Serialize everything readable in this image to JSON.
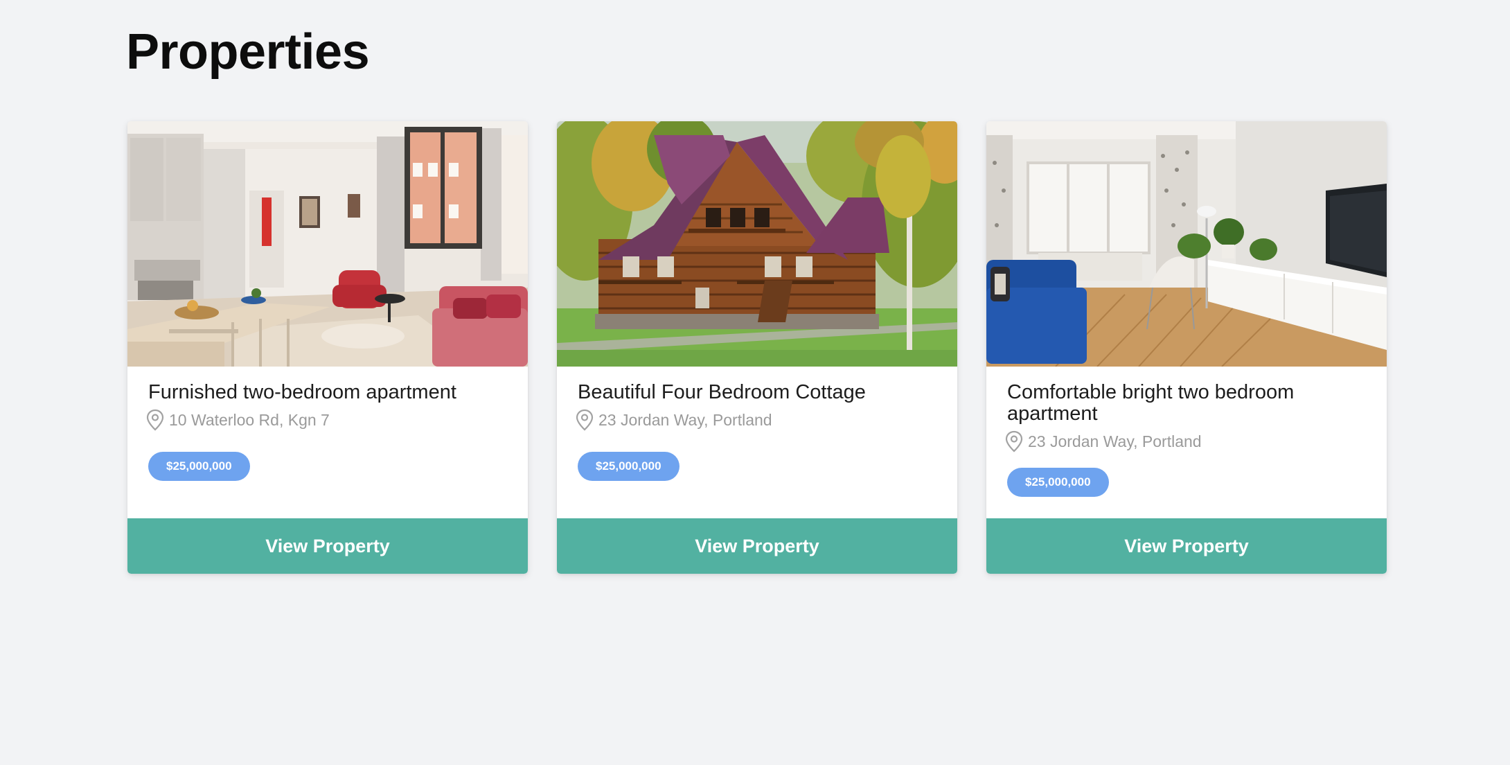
{
  "page": {
    "title": "Properties"
  },
  "colors": {
    "background": "#f2f3f5",
    "price_badge": "#6ea3ef",
    "button": "#52b1a1"
  },
  "properties": [
    {
      "title": "Furnished two-bedroom apartment",
      "address": "10 Waterloo Rd, Kgn 7",
      "price": "$25,000,000",
      "button_label": "View Property",
      "image_subject": "furnished apartment interior with kitchen, red armchair and pink sofa"
    },
    {
      "title": "Beautiful Four Bedroom Cottage",
      "address": "23 Jordan Way, Portland",
      "price": "$25,000,000",
      "button_label": "View Property",
      "image_subject": "log cabin cottage with purple roof surrounded by autumn trees and lawn"
    },
    {
      "title": "Comfortable bright two bedroom apartment",
      "address": "23 Jordan Way, Portland",
      "price": "$25,000,000",
      "button_label": "View Property",
      "image_subject": "bright living room with blue sofa, white cabinets, TV and herringbone floor"
    }
  ],
  "icons": {
    "location": "map-pin-icon"
  }
}
